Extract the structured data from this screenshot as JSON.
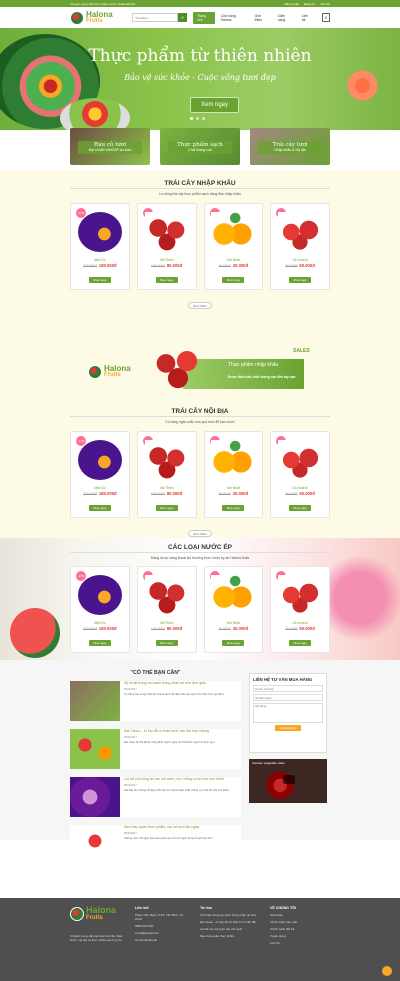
{
  "topbar": {
    "left": "Chuyên cung cấp thực phẩm sạch | HalonaFruits",
    "login": "Đăng nhập",
    "register": "Đăng ký",
    "contact": "Liên hệ"
  },
  "header": {
    "logo_line1": "Halona",
    "logo_line2": "Fruits",
    "search_placeholder": "Tìm kiếm...",
    "nav": [
      "Trang chủ",
      "Cửa hàng Halona",
      "Giới thiệu",
      "Cẩm nang",
      "Liên hệ"
    ],
    "cart_count": "0"
  },
  "hero": {
    "title": "Thực phẩm từ thiên nhiên",
    "subtitle": "Bảo vệ sức khỏe - Cuộc sống tươi đẹp",
    "button": "Xem ngay",
    "dots": 3
  },
  "categories": [
    {
      "label": "Rau củ tươi",
      "desc": "Đạt chuẩn VietGAP an toàn"
    },
    {
      "label": "Thực phẩm sạch",
      "desc": "Chất lượng cao"
    },
    {
      "label": "Trái cây tươi",
      "desc": "Nhập khẩu & nội địa"
    }
  ],
  "sections": {
    "import": {
      "title": "TRÁI CÂY NHẬP KHẨU",
      "desc": "Là dòng trái cây thực phẩm sạch hàng đầu nhập khẩu"
    },
    "domestic": {
      "title": "TRÁI CÂY NỘI ĐỊA",
      "desc": "Có hàng ngàn mẫu hoa quả tươi để bạn chọn!"
    },
    "juice": {
      "title": "CÁC LOẠI NƯỚC ÉP",
      "desc": "Mang lại sự sảng khoái khi thưởng thức nước ép tại Halona fruits"
    },
    "more": "Xem thêm"
  },
  "products": [
    {
      "name": "Mận Úc",
      "old": "220.000đ",
      "price": "180.000đ",
      "badge": "-17%",
      "buy": "Mua ngay"
    },
    {
      "name": "Vải Thiều",
      "old": "120.000đ",
      "price": "80.000đ",
      "badge": "-33%",
      "buy": "Mua ngay"
    },
    {
      "name": "Mơ Nhật",
      "old": "60.000đ",
      "price": "30.000đ",
      "badge": "-50%",
      "buy": "Mua ngay"
    },
    {
      "name": "Cà chua bi",
      "old": "80.000đ",
      "price": "60.000đ",
      "badge": "-25%",
      "buy": "Mua ngay"
    }
  ],
  "banner": {
    "logo1": "Halona",
    "logo2": "Fruits",
    "line1": "Thực phẩm nhập khẩu",
    "line2": "Được đảm bảo chất lượng cao đến tay bạn",
    "sale": "SALES"
  },
  "blog": {
    "header": "\"CÓ THỂ BẠN CẦN\"",
    "posts": [
      {
        "title": "Kỹ thuật trồng rau sạch trong chậu tại nhà đơn giản",
        "date": "28/11/2017",
        "excerpt": "Tự trồng rau trong chậu tại nhà là cách để đảm bảo rau sạch cho bữa cơm gia đình."
      },
      {
        "title": "Eat Clean – bí kíp để có thân hình cân đối nhẹ nhàng",
        "date": "28/11/2017",
        "excerpt": "Eat clean là chế độ ăn uống lành mạnh, giúp cơ thể khỏe mạnh và thon gọn."
      },
      {
        "title": "Lời kể cúc từng ăn rau cải xanh, tím, trắng có lợi cho sức khỏe",
        "date": "28/11/2017",
        "excerpt": "Cải bắp tím không chỉ đẹp mắt mà còn chứa nhiều chất chống oxy hóa tốt cho sức khỏe."
      },
      {
        "title": "Mẹo bảo quản thực phẩm, rau củ tươi lâu ngày",
        "date": "28/11/2017",
        "excerpt": "Những mẹo nhỏ giúp bạn bảo quản rau củ tươi ngon trong tủ lạnh lâu hơn."
      }
    ]
  },
  "contact_form": {
    "title": "LIÊN HỆ TƯ VẤN MUA HÀNG",
    "name": "Họ tên của bạn",
    "phone": "Số điện thoại",
    "message": "Nội dung",
    "submit": "Gửi thông tin"
  },
  "video": {
    "title": "Vietnam vegetable video"
  },
  "footer": {
    "logo1": "Halona",
    "logo2": "Fruits",
    "about": "Chuyên cung cấp các loại trái cây nhập khẩu, nội địa và thực phẩm sạch uy tín.",
    "address": "Phạm Văn Bạch, P.15, Tân Bình, Tp. HCM",
    "phone": "0986.000.000",
    "email": "email@gmail.com",
    "facebook": "fb.com/facebook",
    "news_title": "Tin tức",
    "news": [
      "Kỹ thuật trồng rau sạch trong chậu tại nhà",
      "Eat Clean – bí kíp để có thân hình cân đối",
      "Lời kể cúc từng ăn rau cải xanh",
      "Mẹo bảo quản thực phẩm"
    ],
    "links_title": "Liên kết",
    "why_title": "VỀ CHÚNG TÔI",
    "why": [
      "Giới thiệu",
      "Chính sách bảo mật",
      "Chính sách đổi trả",
      "Tuyển dụng",
      "Liên hệ"
    ]
  },
  "colors": {
    "brand": "#6aa332",
    "accent": "#f9a825",
    "sale": "#e53935"
  }
}
